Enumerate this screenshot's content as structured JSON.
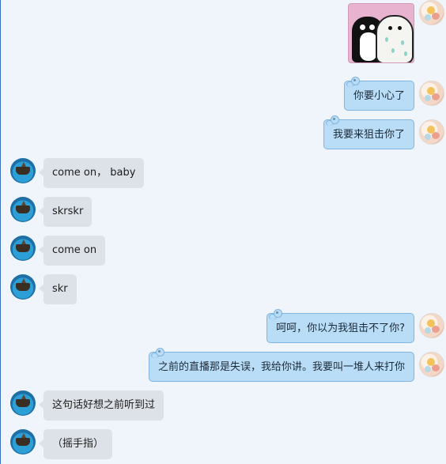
{
  "messages": [
    {
      "id": "m1",
      "side": "right",
      "type": "sticker",
      "sticker_name": "penguin-hugging-seal-sticker"
    },
    {
      "id": "m2",
      "side": "right",
      "type": "text",
      "text": "你要小心了"
    },
    {
      "id": "m3",
      "side": "right",
      "type": "text",
      "text": "我要来狙击你了"
    },
    {
      "id": "m4",
      "side": "left",
      "type": "text",
      "text": "come on， baby"
    },
    {
      "id": "m5",
      "side": "left",
      "type": "text",
      "text": "skrskr"
    },
    {
      "id": "m6",
      "side": "left",
      "type": "text",
      "text": "come on"
    },
    {
      "id": "m7",
      "side": "left",
      "type": "text",
      "text": "skr"
    },
    {
      "id": "m8",
      "side": "right",
      "type": "text",
      "text": "呵呵，你以为我狙击不了你?"
    },
    {
      "id": "m9",
      "side": "right",
      "type": "text",
      "text": "之前的直播那是失误，我给你讲。我要叫一堆人来打你"
    },
    {
      "id": "m10",
      "side": "left",
      "type": "text",
      "text": "这句话好想之前听到过"
    },
    {
      "id": "m11",
      "side": "left",
      "type": "text",
      "text": "（摇手指）"
    }
  ],
  "colors": {
    "background": "#f0f4fb",
    "incoming_bubble": "#dde1e8",
    "outgoing_bubble": "#b9dcf7",
    "outgoing_border": "#7fb5de"
  }
}
